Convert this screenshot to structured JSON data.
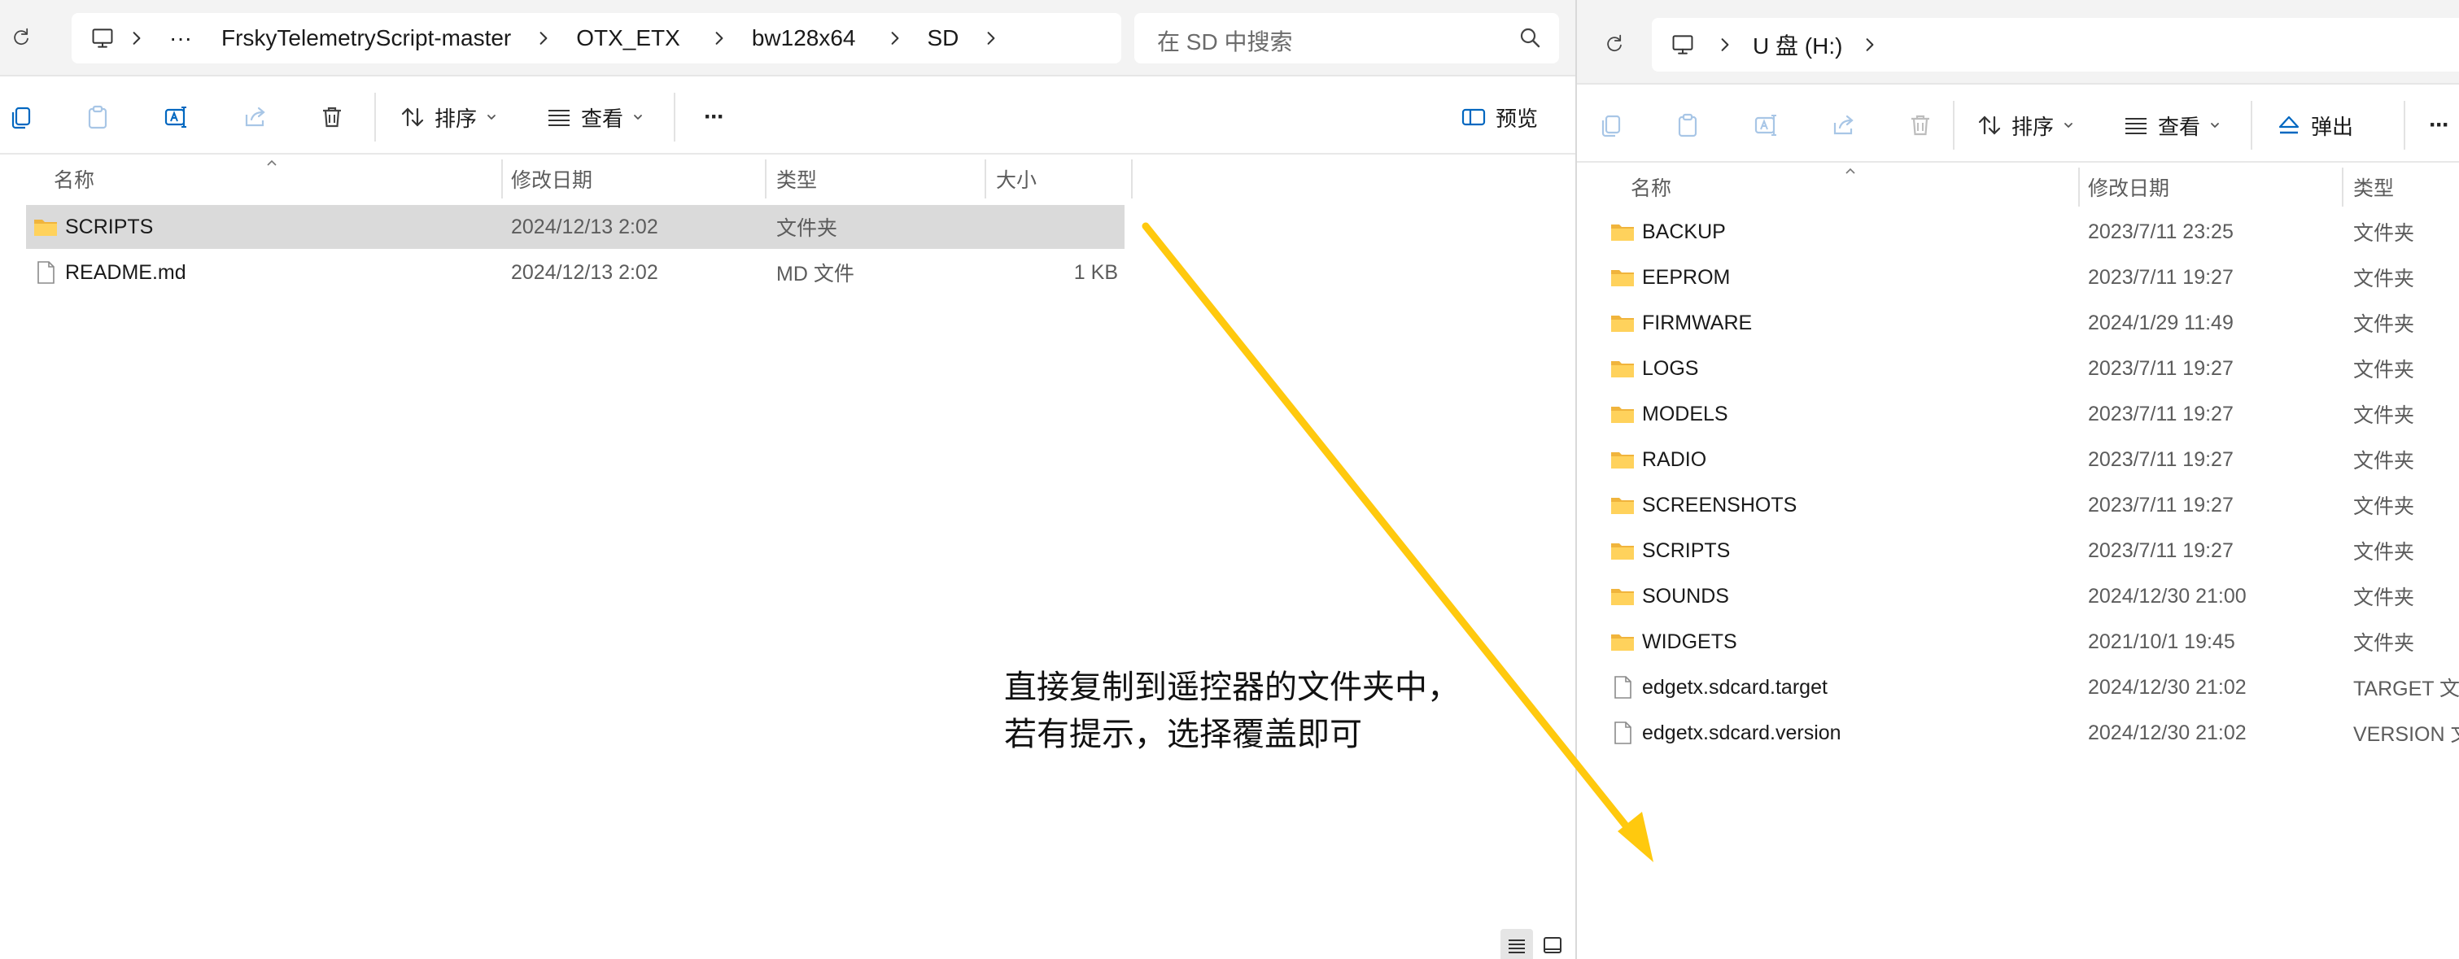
{
  "colors": {
    "accent": "#0067c0",
    "folder": "#f7c242",
    "arrow": "#ffc90e",
    "selected_row": "#dadada"
  },
  "left_explorer": {
    "breadcrumb": [
      "FrskyTelemetryScript-master",
      "OTX_ETX",
      "bw128x64",
      "SD"
    ],
    "breadcrumb_overflow": "···",
    "search_placeholder": "在 SD 中搜索",
    "toolbar": {
      "sort": "排序",
      "view": "查看",
      "preview": "预览",
      "more": "···"
    },
    "columns": {
      "name": "名称",
      "modified": "修改日期",
      "type": "类型",
      "size": "大小"
    },
    "files": [
      {
        "name": "SCRIPTS",
        "modified": "2024/12/13 2:02",
        "type": "文件夹",
        "size": "",
        "icon": "folder-icon",
        "selected": true
      },
      {
        "name": "README.md",
        "modified": "2024/12/13 2:02",
        "type": "MD 文件",
        "size": "1 KB",
        "icon": "file-icon",
        "selected": false
      }
    ]
  },
  "right_explorer": {
    "breadcrumb": [
      "U 盘 (H:)"
    ],
    "toolbar": {
      "sort": "排序",
      "view": "查看",
      "eject": "弹出",
      "more": "···"
    },
    "columns": {
      "name": "名称",
      "modified": "修改日期",
      "type": "类型"
    },
    "files": [
      {
        "name": "BACKUP",
        "modified": "2023/7/11 23:25",
        "type": "文件夹",
        "icon": "folder-icon"
      },
      {
        "name": "EEPROM",
        "modified": "2023/7/11 19:27",
        "type": "文件夹",
        "icon": "folder-icon"
      },
      {
        "name": "FIRMWARE",
        "modified": "2024/1/29 11:49",
        "type": "文件夹",
        "icon": "folder-icon"
      },
      {
        "name": "LOGS",
        "modified": "2023/7/11 19:27",
        "type": "文件夹",
        "icon": "folder-icon"
      },
      {
        "name": "MODELS",
        "modified": "2023/7/11 19:27",
        "type": "文件夹",
        "icon": "folder-icon"
      },
      {
        "name": "RADIO",
        "modified": "2023/7/11 19:27",
        "type": "文件夹",
        "icon": "folder-icon"
      },
      {
        "name": "SCREENSHOTS",
        "modified": "2023/7/11 19:27",
        "type": "文件夹",
        "icon": "folder-icon"
      },
      {
        "name": "SCRIPTS",
        "modified": "2023/7/11 19:27",
        "type": "文件夹",
        "icon": "folder-icon"
      },
      {
        "name": "SOUNDS",
        "modified": "2024/12/30 21:00",
        "type": "文件夹",
        "icon": "folder-icon"
      },
      {
        "name": "WIDGETS",
        "modified": "2021/10/1 19:45",
        "type": "文件夹",
        "icon": "folder-icon"
      },
      {
        "name": "edgetx.sdcard.target",
        "modified": "2024/12/30 21:02",
        "type": "TARGET 文件",
        "icon": "file-icon"
      },
      {
        "name": "edgetx.sdcard.version",
        "modified": "2024/12/30 21:02",
        "type": "VERSION 文件",
        "icon": "file-icon"
      }
    ]
  },
  "annotation": {
    "line1": "直接复制到遥控器的文件夹中，",
    "line2": "若有提示，选择覆盖即可"
  }
}
